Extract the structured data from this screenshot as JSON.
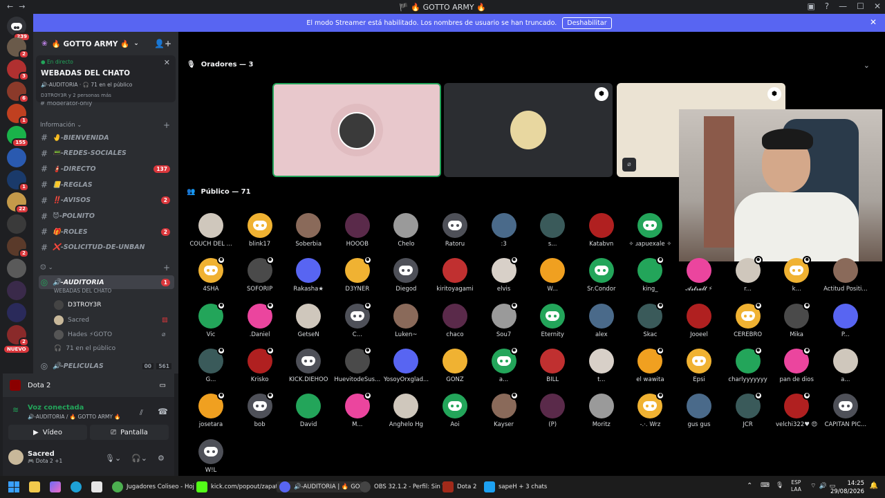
{
  "window": {
    "title": "🏴 🔥 GOTTO ARMY 🔥",
    "back": "←",
    "forward": "→"
  },
  "streamer_bar": {
    "message": "El modo Streamer está habilitado. Los nombres de usuario se han truncado.",
    "disable_label": "Deshabilitar"
  },
  "rail": {
    "dm_badge": "239",
    "nuevo": "NUEVO",
    "badges": [
      "2",
      "3",
      "6",
      "1",
      "155",
      "",
      "1",
      "22",
      "",
      "2",
      "",
      "",
      "",
      "2"
    ]
  },
  "guild": {
    "name": "🔥 GOTTO ARMY 🔥"
  },
  "live_card": {
    "status": "En directo",
    "title": "WEBADAS DEL CHATO",
    "meta": "🔊-AUDITORIA · 🎧 71 en el público",
    "listeners": "D3TROY3R y 2 personas más",
    "partial_channel": "moderator-only"
  },
  "categories": {
    "info": "Información",
    "voice_cat": "😊"
  },
  "channels": [
    {
      "label": "🤚-BIENVENIDA",
      "badge": ""
    },
    {
      "label": "📟-REDES-SOCIALES",
      "badge": ""
    },
    {
      "label": "🧯-DIRECTO",
      "badge": "137"
    },
    {
      "label": "📒-REGLAS",
      "badge": ""
    },
    {
      "label": "‼️-AVISOS",
      "badge": "2"
    },
    {
      "label": "😈-POLNITO",
      "badge": ""
    },
    {
      "label": "🎁-ROLES",
      "badge": "2"
    },
    {
      "label": "❌-SOLICITUD-DE-UNBAN",
      "badge": ""
    }
  ],
  "voice_channel": {
    "label": "🔊-AUDITORIA",
    "badge": "1",
    "sub": "WEBADAS DEL CHATO",
    "users": [
      "D3TROY3R",
      "Sacred",
      "Hades ⚡GOTO"
    ],
    "audience": "71 en el público"
  },
  "next_channel": {
    "label": "🔊-PELICULAS",
    "count_a": "00",
    "count_b": "561"
  },
  "panel": {
    "activity": "Dota 2",
    "vc_title": "Voz conectada",
    "vc_sub": "🔊-AUDITORIA / 🔥 GOTTO ARMY 🔥",
    "video": "Vídeo",
    "screen": "Pantalla",
    "user": "Sacred",
    "user_status": "🎮 Dota 2 +1"
  },
  "stage": {
    "speakers": "Oradores — 3",
    "audience": "Público — 71"
  },
  "audience": [
    [
      "COUCH DEL ...",
      "blink17",
      "Soberbia",
      "HOOOB",
      "Chelo",
      "Ratoru",
      ":3",
      "s...",
      "Katabvn",
      "✧ ɹapuexale ✧"
    ],
    [
      "4SHA",
      "SOFORIP",
      "Rakasha★",
      "D3YNER",
      "Diegod",
      "kiritoyagami",
      "elvis",
      "W...",
      "Sr.Condor",
      "king_",
      "𝓐𝓼𝓽𝓻𝓪𝓵𝓽 ⚡",
      "r...",
      "k...",
      "Actitud Positi..."
    ],
    [
      "Vic",
      ".Daniel",
      "GetseN",
      "C...",
      "Luken~",
      "chaco",
      "Sou7",
      "Eternity",
      "alex",
      "Skac",
      "Jooeel",
      "CEREBRO",
      "Mika",
      "P..."
    ],
    [
      "G...",
      "Krisko",
      "KICK.DIEHOO",
      "HuevitodeSus...",
      "YosoyOrxglad...",
      "GONZ",
      "a...",
      "BILL",
      "t...",
      "el wawita",
      "Epsi",
      "charlyyyyyyy",
      "pan de dios",
      "a..."
    ],
    [
      "josetara",
      "bob",
      "David",
      "M...",
      "Anghelo Hg",
      "Aoi",
      "Kayser",
      "(P)",
      "Moritz",
      "-.·. Wrz",
      "gus gus",
      "JCR",
      "velchi322♥ 😍",
      "CAPITAN PIC..."
    ],
    [
      "W!L"
    ]
  ],
  "taskbar": {
    "items": [
      "Jugadores Coliseo - Hoj",
      "kick.com/popout/zapati",
      "🔊-AUDITORIA | 🔥 GO",
      "OBS 32.1.2 - Perfil: Sin Tí",
      "Dota 2",
      "sapeH + 3 chats"
    ],
    "lang": "ESP",
    "lang2": "LAA",
    "time": "14:25",
    "date": "29/08/2026"
  },
  "colors": {
    "accent": "#5865f2",
    "green": "#23a55a",
    "red": "#da373c"
  }
}
